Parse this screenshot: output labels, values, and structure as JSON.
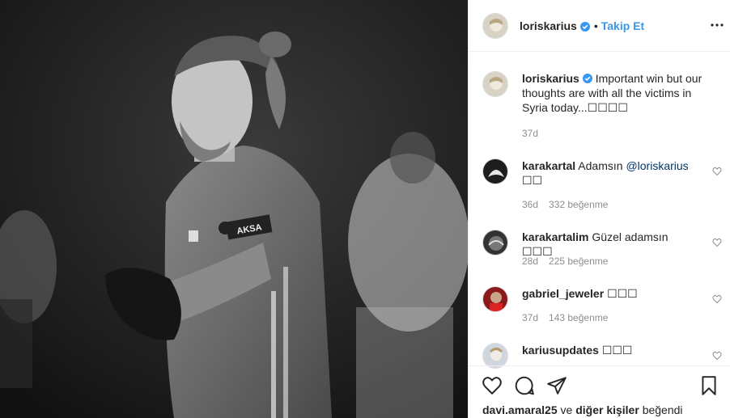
{
  "post": {
    "username": "loriskarius",
    "separator": "•",
    "follow_label": "Takip Et"
  },
  "caption": {
    "username": "loriskarius",
    "text": "Important win but our thoughts are with all the victims in Syria today...",
    "emojis": "☐☐☐☐",
    "time": "37d"
  },
  "comments": [
    {
      "username": "karakartal",
      "text": "Adamsın",
      "mention": "@loriskarius",
      "emojis": "☐☐",
      "time": "36d",
      "likes": "332 beğenme"
    },
    {
      "username": "karakartalim",
      "text": "Güzel adamsın",
      "mention": "",
      "emojis": "☐☐☐",
      "time": "28d",
      "likes": "225 beğenme"
    },
    {
      "username": "gabriel_jeweler",
      "text": "",
      "mention": "",
      "emojis": "☐☐☐",
      "time": "37d",
      "likes": "143 beğenme"
    },
    {
      "username": "kariusupdates",
      "text": "",
      "mention": "",
      "emojis": "☐☐☐",
      "time": "",
      "likes": ""
    }
  ],
  "likes_line": {
    "user": "davi.amaral25",
    "connector": "ve",
    "others": "diğer kişiler",
    "suffix": "beğendi"
  },
  "photo_text": {
    "sleeve": "AKSA"
  },
  "colors": {
    "accent": "#3897f0",
    "verified": "#3897f0",
    "muted": "#8e8e8e"
  },
  "icons": [
    "heart-icon",
    "comment-icon",
    "share-icon",
    "bookmark-icon",
    "more-icon",
    "verified-icon"
  ]
}
